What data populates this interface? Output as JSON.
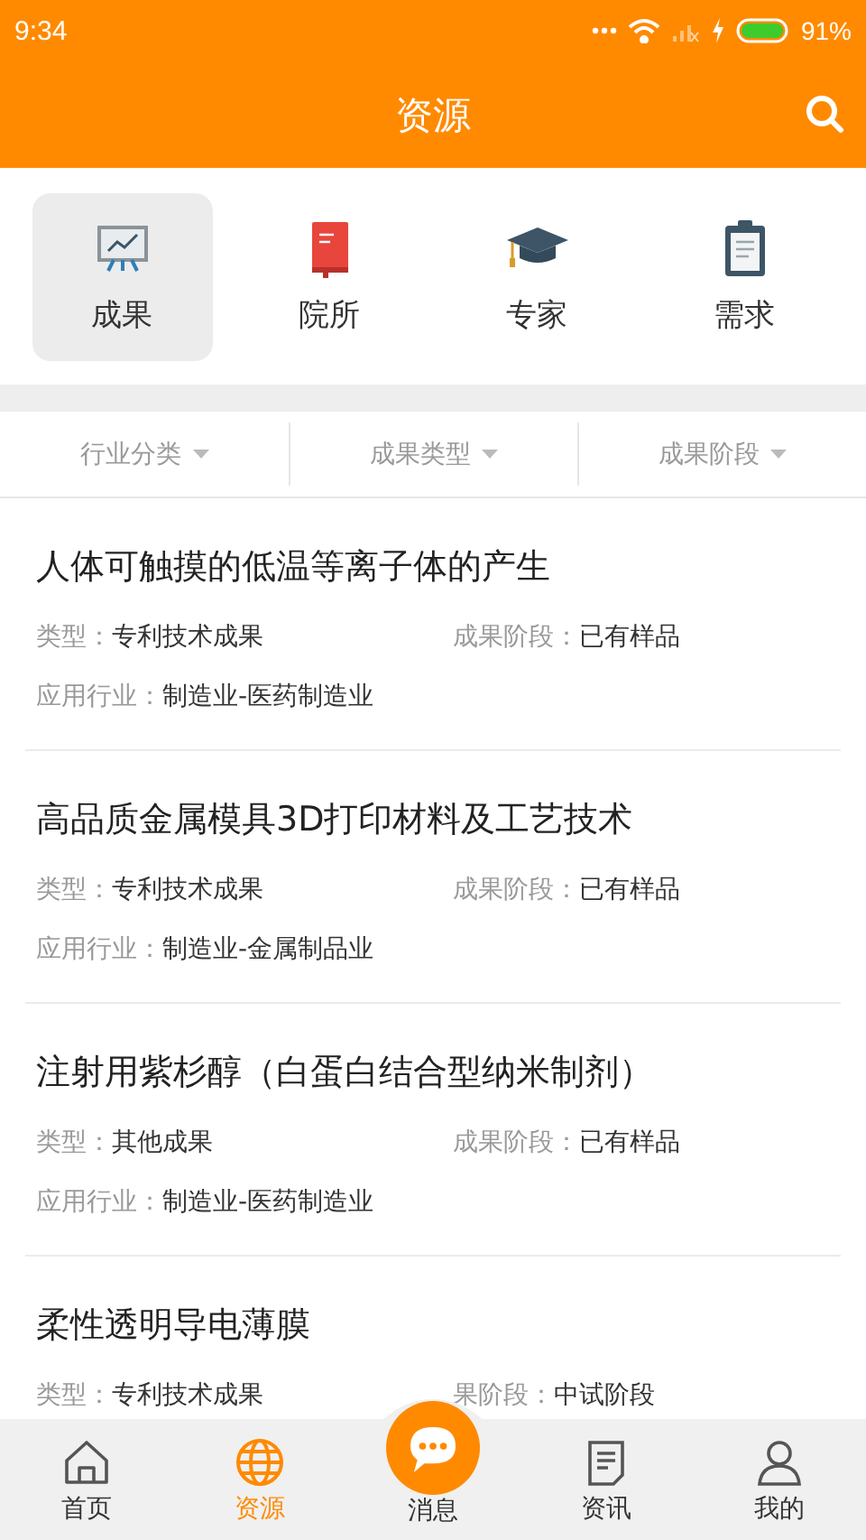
{
  "status_bar": {
    "time": "9:34",
    "battery": "91%"
  },
  "header": {
    "title": "资源"
  },
  "categories": [
    {
      "label": "成果",
      "kind": "chart",
      "selected": true
    },
    {
      "label": "院所",
      "kind": "book",
      "selected": false
    },
    {
      "label": "专家",
      "kind": "cap",
      "selected": false
    },
    {
      "label": "需求",
      "kind": "clipboard",
      "selected": false
    }
  ],
  "filters": [
    "行业分类",
    "成果类型",
    "成果阶段"
  ],
  "results": [
    {
      "title": "人体可触摸的低温等离子体的产生",
      "type_label": "类型：",
      "type": "专利技术成果",
      "stage_label": "成果阶段：",
      "stage": "已有样品",
      "industry_label": "应用行业：",
      "industry": "制造业-医药制造业"
    },
    {
      "title": "高品质金属模具3D打印材料及工艺技术",
      "type_label": "类型：",
      "type": "专利技术成果",
      "stage_label": "成果阶段：",
      "stage": "已有样品",
      "industry_label": "应用行业：",
      "industry": "制造业-金属制品业"
    },
    {
      "title": "注射用紫杉醇（白蛋白结合型纳米制剂）",
      "type_label": "类型：",
      "type": "其他成果",
      "stage_label": "成果阶段：",
      "stage": "已有样品",
      "industry_label": "应用行业：",
      "industry": "制造业-医药制造业"
    },
    {
      "title": "柔性透明导电薄膜",
      "type_label": "类型：",
      "type": "专利技术成果",
      "stage_label": "果阶段：",
      "stage": "中试阶段"
    }
  ],
  "nav": [
    {
      "label": "首页",
      "kind": "home",
      "selected": false
    },
    {
      "label": "资源",
      "kind": "globe",
      "selected": true
    },
    {
      "label": "消息",
      "kind": "chat",
      "selected": false
    },
    {
      "label": "资讯",
      "kind": "doc",
      "selected": false
    },
    {
      "label": "我的",
      "kind": "person",
      "selected": false
    }
  ]
}
